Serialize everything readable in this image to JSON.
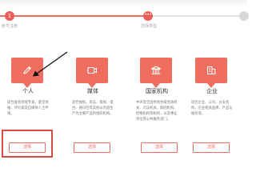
{
  "steps": [
    {
      "number": "1",
      "label": "帐号注册"
    },
    {
      "number": "2",
      "label": "选择类型"
    },
    {
      "number": "",
      "label": ""
    }
  ],
  "cards": [
    {
      "title": "个人",
      "icon": "pen-icon",
      "description": "适合垂直领域专家、意见领袖、评论家及自媒体人士申请。",
      "button": "选择"
    },
    {
      "title": "媒体",
      "icon": "video-icon",
      "description": "适合报纸、杂志、电视、电台、通讯社等其他以内容生产为主要产品的组织机构。",
      "button": "选择"
    },
    {
      "title": "国家机构",
      "icon": "government-building-icon",
      "description": "中央及全国各地各级党政机关、司法机关、群团机构、检察机构等机构，以及事业单位等公共服务部门。",
      "button": "选择"
    },
    {
      "title": "企业",
      "icon": "company-building-icon",
      "description": "适合企业、公司、分支机构、企业相关品牌、产品与服务等。",
      "button": "选择"
    }
  ],
  "colors": {
    "accent": "#ef6e5f",
    "active_step": "#ee5d58",
    "inactive_step": "#d8d8d8",
    "highlight": "#d94a44"
  }
}
